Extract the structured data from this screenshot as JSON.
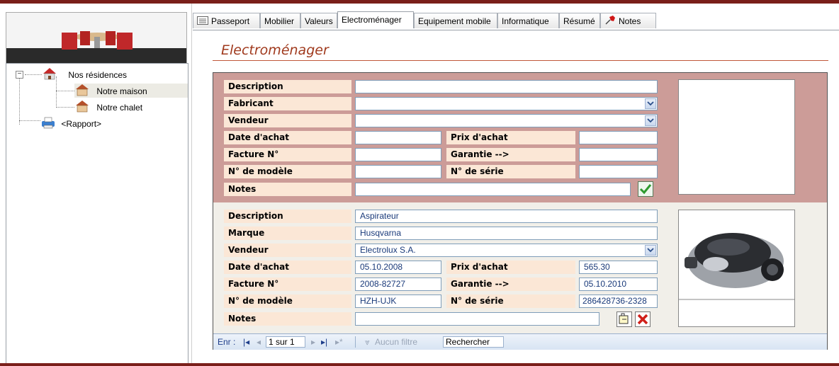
{
  "tree": {
    "root": "Nos résidences",
    "children": [
      "Notre maison",
      "Notre chalet"
    ],
    "report": "<Rapport>"
  },
  "tabs": [
    {
      "label": "Passeport"
    },
    {
      "label": "Mobilier"
    },
    {
      "label": "Valeurs"
    },
    {
      "label": "Electroménager"
    },
    {
      "label": "Equipement mobile"
    },
    {
      "label": "Informatique"
    },
    {
      "label": "Résumé"
    },
    {
      "label": "Notes"
    }
  ],
  "page_title": "Electroménager",
  "new_record": {
    "labels": {
      "description": "Description",
      "fabricant": "Fabricant",
      "vendeur": "Vendeur",
      "date_achat": "Date d'achat",
      "prix_achat": "Prix d'achat",
      "facture": "Facture N°",
      "garantie": "Garantie -->",
      "modele": "N° de modèle",
      "serie": "N° de série",
      "notes": "Notes"
    }
  },
  "record": {
    "labels": {
      "description": "Description",
      "marque": "Marque",
      "vendeur": "Vendeur",
      "date_achat": "Date d'achat",
      "prix_achat": "Prix d'achat",
      "facture": "Facture N°",
      "garantie": "Garantie -->",
      "modele": "N° de modèle",
      "serie": "N° de série",
      "notes": "Notes"
    },
    "values": {
      "description": "Aspirateur",
      "marque": "Husqvarna",
      "vendeur": "Electrolux S.A.",
      "date_achat": "05.10.2008",
      "prix_achat": "565.30",
      "facture": "2008-82727",
      "garantie": "05.10.2010",
      "modele": "HZH-UJK",
      "serie": "286428736-2328",
      "notes": ""
    }
  },
  "navigation": {
    "label": "Enr :",
    "position": "1 sur 1",
    "filter": "Aucun filtre",
    "search": "Rechercher"
  },
  "colors": {
    "header_band": "#7a1f1a",
    "title": "#a03a1e",
    "new_record_bg": "#cc9c98",
    "label_bg": "#fbe7d6"
  }
}
